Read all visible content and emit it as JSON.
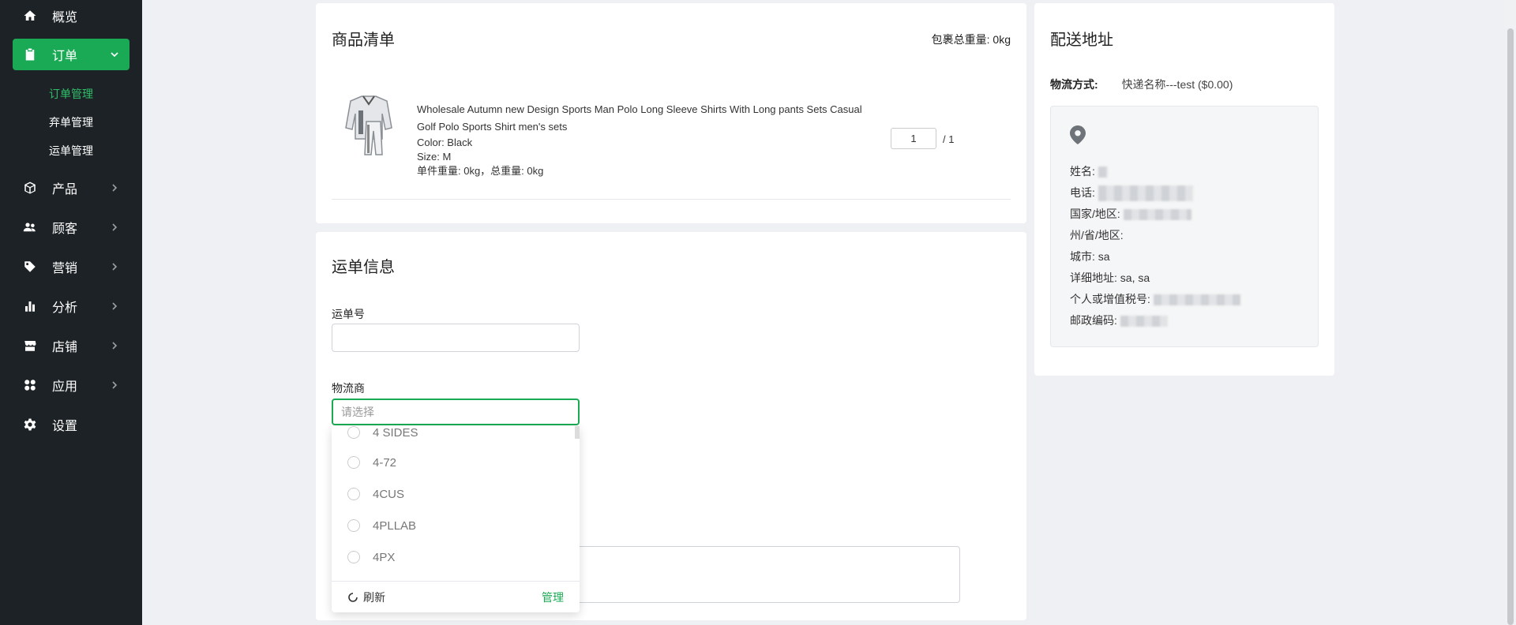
{
  "sidebar": {
    "items": [
      {
        "label": "概览",
        "icon": "home-icon"
      },
      {
        "label": "订单",
        "icon": "clipboard-icon"
      },
      {
        "label": "产品",
        "icon": "box-icon"
      },
      {
        "label": "顾客",
        "icon": "users-icon"
      },
      {
        "label": "营销",
        "icon": "tag-icon"
      },
      {
        "label": "分析",
        "icon": "bar-chart-icon"
      },
      {
        "label": "店铺",
        "icon": "store-icon"
      },
      {
        "label": "应用",
        "icon": "apps-icon"
      },
      {
        "label": "设置",
        "icon": "gear-icon"
      }
    ],
    "order_subitems": [
      "订单管理",
      "弃单管理",
      "运单管理"
    ],
    "active_color": "#1aaa55"
  },
  "items_card": {
    "title": "商品清单",
    "weight_label": "包裹总重量:",
    "weight_value": "0kg",
    "product": {
      "name_line1": "Wholesale Autumn new Design Sports Man Polo Long Sleeve Shirts With Long pants Sets Casual",
      "name_line2": "Golf Polo Sports Shirt men's sets",
      "color": "Color: Black",
      "size": "Size: M",
      "weight": "单件重量: 0kg，总重量: 0kg",
      "qty": "1",
      "qty_total": "/  1"
    }
  },
  "shipment_card": {
    "title": "运单信息",
    "tracking_label": "运单号",
    "tracking_value": "",
    "carrier_label": "物流商",
    "carrier_placeholder": "请选择",
    "options": [
      "4 SIDES",
      "4-72",
      "4CUS",
      "4PLLAB",
      "4PX"
    ],
    "refresh_label": "刷新",
    "manage_label": "管理"
  },
  "address_card": {
    "title": "配送地址",
    "method_label": "物流方式:",
    "method_value": "快递名称---test ($0.00)",
    "rows": [
      {
        "label": "姓名:"
      },
      {
        "label": "电话:"
      },
      {
        "label": "国家/地区:"
      },
      {
        "label": "州/省/地区:"
      },
      {
        "label": "城市: sa"
      },
      {
        "label": "详细地址: sa, sa"
      },
      {
        "label": "个人或增值税号:"
      },
      {
        "label": "邮政编码:"
      }
    ]
  }
}
